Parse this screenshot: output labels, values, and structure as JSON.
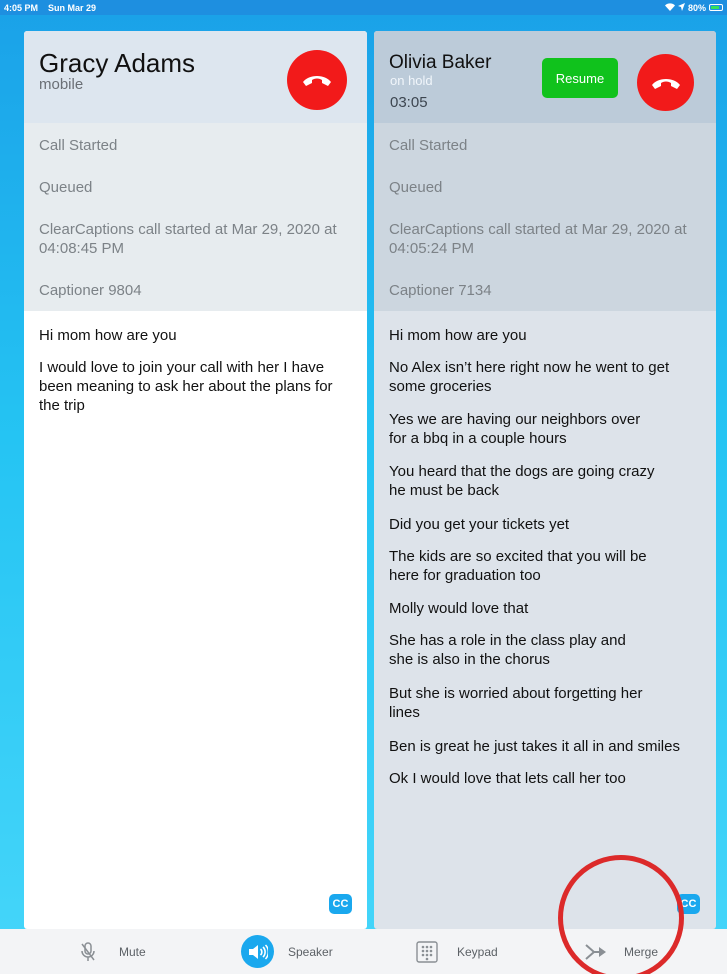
{
  "status_bar": {
    "time": "4:05 PM",
    "date": "Sun Mar 29",
    "battery": "80%",
    "battery_level": 0.8
  },
  "left_call": {
    "name": "Gracy Adams",
    "subtitle": "mobile",
    "log": [
      "Call Started",
      "Queued",
      "ClearCaptions call started at Mar 29, 2020 at 04:08:45 PM",
      "Captioner 9804"
    ],
    "transcript": [
      "Hi mom how are you",
      "I would love to join your call with her I have been meaning to ask her about the plans for the trip"
    ],
    "cc_label": "CC"
  },
  "right_call": {
    "name": "Olivia Baker",
    "status": "on hold",
    "timer": "03:05",
    "resume_label": "Resume",
    "log": [
      "Call Started",
      "Queued",
      "ClearCaptions call started at Mar 29, 2020 at 04:05:24 PM",
      "Captioner 7134"
    ],
    "transcript": [
      "Hi mom how are you",
      "No Alex isn’t here right now he went to get some groceries",
      "Yes we are having our neighbors over\nfor a bbq in a couple hours",
      "You heard that the dogs are going crazy\nhe must be back",
      "Did you get your tickets yet",
      "The kids are so excited that you will be\nhere for graduation too",
      "Molly would love that",
      "She has a role in the class play and\nshe is also in the chorus",
      "But she is worried about forgetting her\nlines",
      "Ben is great he just takes it all in and smiles",
      "Ok I would love that lets call her too"
    ],
    "cc_label": "CC"
  },
  "toolbar": {
    "mute_label": "Mute",
    "speaker_label": "Speaker",
    "keypad_label": "Keypad",
    "merge_label": "Merge"
  },
  "colors": {
    "hangup": "#f21a1a",
    "resume": "#10c21c",
    "accent": "#1aa8ee",
    "highlight": "#dc2a2a"
  }
}
